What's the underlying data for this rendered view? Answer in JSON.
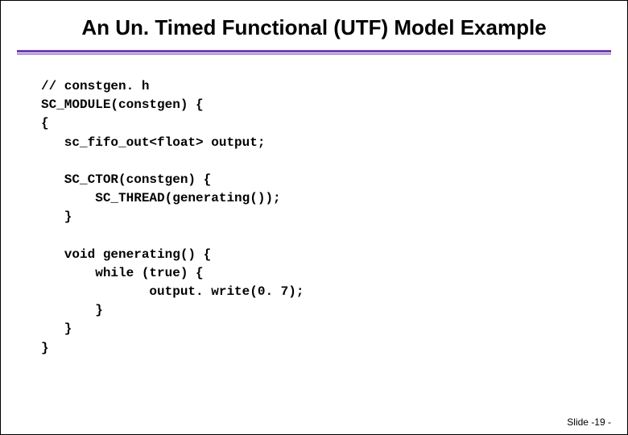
{
  "title": "An Un. Timed Functional (UTF) Model Example",
  "code": {
    "line1": "// constgen. h",
    "line2": "SC_MODULE(constgen) {",
    "line3": "{",
    "line4": "   sc_fifo_out<float> output;",
    "line5": "",
    "line6": "   SC_CTOR(constgen) {",
    "line7": "       SC_THREAD(generating());",
    "line8": "   }",
    "line9": "",
    "line10": "   void generating() {",
    "line11": "       while (true) {",
    "line12": "              output. write(0. 7);",
    "line13": "       }",
    "line14": "   }",
    "line15": "}"
  },
  "footer": "Slide -19 -"
}
